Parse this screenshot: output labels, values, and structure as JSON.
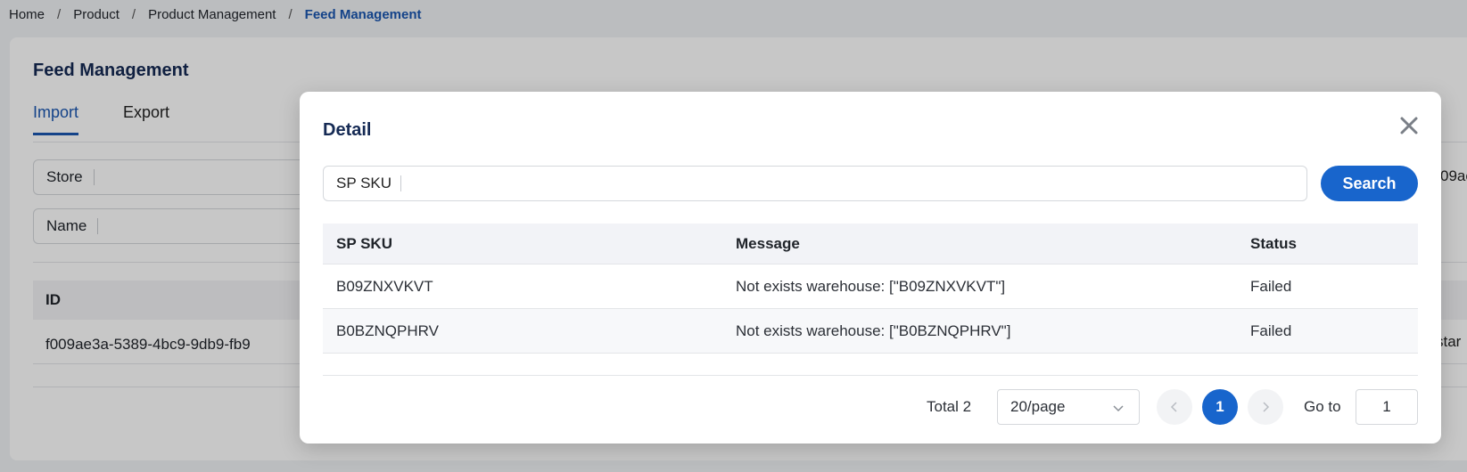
{
  "breadcrumb": {
    "items": [
      "Home",
      "Product",
      "Product Management"
    ],
    "current": "Feed Management",
    "separator": "/"
  },
  "page": {
    "title": "Feed Management",
    "tabs": [
      {
        "label": "Import",
        "active": true
      },
      {
        "label": "Export",
        "active": false
      }
    ],
    "filters": {
      "store_label": "Store",
      "name_label": "Name",
      "store_value_partial": "09ae"
    },
    "table": {
      "header_id": "ID",
      "row_id": "f009ae3a-5389-4bc9-9db9-fb9",
      "row_right_partial": "star"
    }
  },
  "modal": {
    "title": "Detail",
    "search": {
      "label": "SP SKU",
      "value": "",
      "button_label": "Search"
    },
    "table": {
      "headers": [
        "SP SKU",
        "Message",
        "Status"
      ],
      "rows": [
        {
          "sku": "B09ZNXVKVT",
          "message": "Not exists warehouse: [\"B09ZNXVKVT\"]",
          "status": "Failed"
        },
        {
          "sku": "B0BZNQPHRV",
          "message": "Not exists warehouse: [\"B0BZNQPHRV\"]",
          "status": "Failed"
        }
      ]
    },
    "pagination": {
      "total_label": "Total 2",
      "page_size": "20/page",
      "current_page": "1",
      "goto_label": "Go to",
      "goto_value": "1"
    }
  },
  "colors": {
    "accent": "#1865cc",
    "title": "#152a54",
    "breadcrumb_current": "#1a56b0"
  }
}
